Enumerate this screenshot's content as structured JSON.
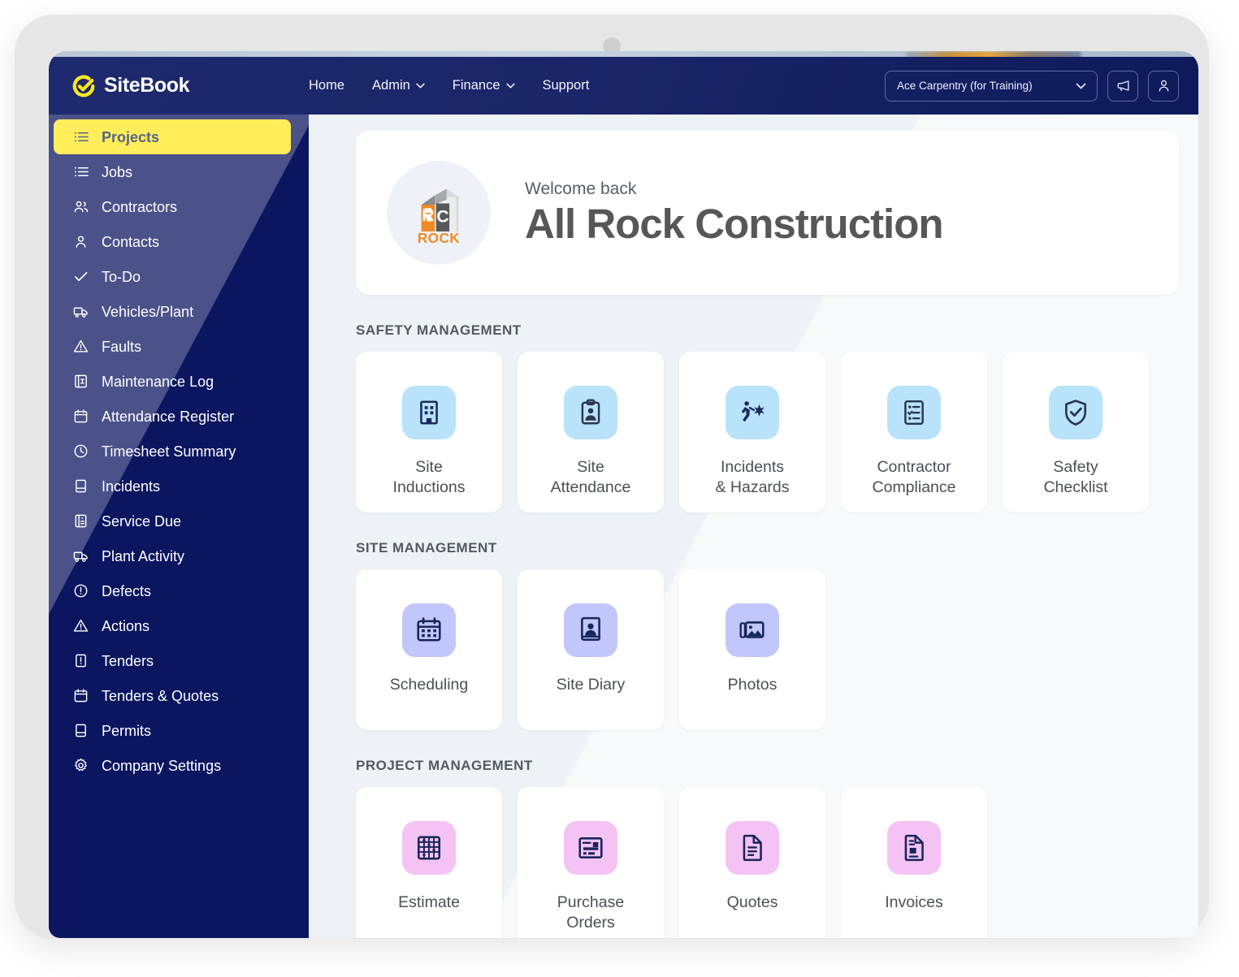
{
  "brand": {
    "name": "SiteBook",
    "logo_icon": "check-circle-icon",
    "accent": "#ffe81f"
  },
  "topnav": {
    "items": [
      {
        "label": "Home",
        "has_caret": false
      },
      {
        "label": "Admin",
        "has_caret": true
      },
      {
        "label": "Finance",
        "has_caret": true
      },
      {
        "label": "Support",
        "has_caret": false
      }
    ],
    "org_selector": {
      "value": "Ace Carpentry (for Training)",
      "icon": "chevron-down-icon"
    },
    "announce_button": {
      "icon": "megaphone-icon"
    },
    "account_button": {
      "icon": "user-icon"
    }
  },
  "sidebar": {
    "items": [
      {
        "label": "Projects",
        "icon": "list-icon",
        "active": true
      },
      {
        "label": "Jobs",
        "icon": "list-icon",
        "active": false
      },
      {
        "label": "Contractors",
        "icon": "users-icon",
        "active": false
      },
      {
        "label": "Contacts",
        "icon": "user-icon",
        "active": false
      },
      {
        "label": "To-Do",
        "icon": "check-icon",
        "active": false
      },
      {
        "label": "Vehicles/Plant",
        "icon": "truck-icon",
        "active": false
      },
      {
        "label": "Faults",
        "icon": "warning-triangle-icon",
        "active": false
      },
      {
        "label": "Maintenance Log",
        "icon": "log-book-icon",
        "active": false
      },
      {
        "label": "Attendance Register",
        "icon": "calendar-icon",
        "active": false
      },
      {
        "label": "Timesheet Summary",
        "icon": "clock-icon",
        "active": false
      },
      {
        "label": "Incidents",
        "icon": "book-icon",
        "active": false
      },
      {
        "label": "Service Due",
        "icon": "service-card-icon",
        "active": false
      },
      {
        "label": "Plant Activity",
        "icon": "truck-icon",
        "active": false
      },
      {
        "label": "Defects",
        "icon": "alert-circle-icon",
        "active": false
      },
      {
        "label": "Actions",
        "icon": "warning-triangle-icon",
        "active": false
      },
      {
        "label": "Tenders",
        "icon": "document-alert-icon",
        "active": false
      },
      {
        "label": "Tenders & Quotes",
        "icon": "calendar-icon",
        "active": false
      },
      {
        "label": "Permits",
        "icon": "book-icon",
        "active": false
      },
      {
        "label": "Company Settings",
        "icon": "gear-icon",
        "active": false
      }
    ]
  },
  "welcome": {
    "kicker": "Welcome back",
    "company": "All Rock Construction",
    "avatar_logo": {
      "top_text": "RC",
      "bottom_text": "ROCK",
      "accent": "#f08a24",
      "secondary": "#58595b"
    }
  },
  "sections": [
    {
      "title": "SAFETY MANAGEMENT",
      "tile_color": "blue",
      "tiles": [
        {
          "label": "Site\nInductions",
          "icon": "building-icon"
        },
        {
          "label": "Site\nAttendance",
          "icon": "clipboard-person-icon"
        },
        {
          "label": "Incidents\n& Hazards",
          "icon": "person-hazard-icon"
        },
        {
          "label": "Contractor\nCompliance",
          "icon": "checklist-icon"
        },
        {
          "label": "Safety\nChecklist",
          "icon": "shield-check-icon"
        }
      ]
    },
    {
      "title": "SITE MANAGEMENT",
      "tile_color": "periwinkle",
      "tiles": [
        {
          "label": "Scheduling",
          "icon": "calendar-grid-icon"
        },
        {
          "label": "Site Diary",
          "icon": "diary-person-icon"
        },
        {
          "label": "Photos",
          "icon": "photos-icon"
        }
      ]
    },
    {
      "title": "PROJECT MANAGEMENT",
      "tile_color": "pink",
      "tiles": [
        {
          "label": "Estimate",
          "icon": "abacus-icon"
        },
        {
          "label": "Purchase\nOrders",
          "icon": "purchase-order-icon"
        },
        {
          "label": "Quotes",
          "icon": "document-icon"
        },
        {
          "label": "Invoices",
          "icon": "invoice-icon"
        }
      ]
    }
  ]
}
